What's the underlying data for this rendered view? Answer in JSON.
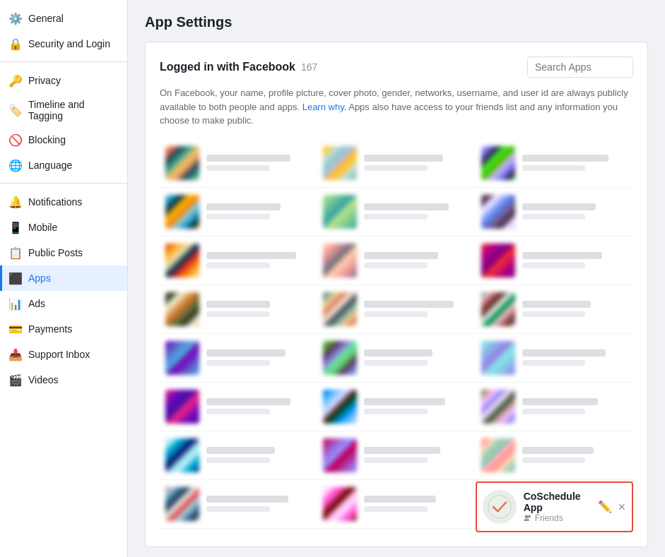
{
  "sidebar": {
    "items": [
      {
        "id": "general",
        "label": "General",
        "icon": "⚙️",
        "active": false
      },
      {
        "id": "security-login",
        "label": "Security and Login",
        "icon": "🔒",
        "active": false
      },
      {
        "id": "privacy",
        "label": "Privacy",
        "icon": "🔑",
        "active": false
      },
      {
        "id": "timeline-tagging",
        "label": "Timeline and Tagging",
        "icon": "🏷️",
        "active": false
      },
      {
        "id": "blocking",
        "label": "Blocking",
        "icon": "🚫",
        "active": false
      },
      {
        "id": "language",
        "label": "Language",
        "icon": "🌐",
        "active": false
      },
      {
        "id": "notifications",
        "label": "Notifications",
        "icon": "🔔",
        "active": false
      },
      {
        "id": "mobile",
        "label": "Mobile",
        "icon": "📱",
        "active": false
      },
      {
        "id": "public-posts",
        "label": "Public Posts",
        "icon": "📋",
        "active": false
      },
      {
        "id": "apps",
        "label": "Apps",
        "icon": "⬛",
        "active": true
      },
      {
        "id": "ads",
        "label": "Ads",
        "icon": "📊",
        "active": false
      },
      {
        "id": "payments",
        "label": "Payments",
        "icon": "💳",
        "active": false
      },
      {
        "id": "support-inbox",
        "label": "Support Inbox",
        "icon": "📥",
        "active": false
      },
      {
        "id": "videos",
        "label": "Videos",
        "icon": "🎬",
        "active": false
      }
    ]
  },
  "main": {
    "page_title": "App Settings",
    "card": {
      "logged_in_title": "Logged in with Facebook",
      "app_count": "167",
      "search_placeholder": "Search Apps",
      "info_text": "On Facebook, your name, profile picture, cover photo, gender, networks, username, and user id are always publicly available to both people and apps.",
      "learn_link_text": "Learn why.",
      "info_text2": "Apps also have access to your friends list and any information you choose to make public."
    }
  },
  "featured_app": {
    "name": "CoSchedule App",
    "sub_label": "Friends",
    "edit_icon": "✏️",
    "close_icon": "✕"
  },
  "colors": {
    "active_bg": "#e7f3ff",
    "active_border": "#1877f2",
    "accent": "#1877f2",
    "featured_border": "#e74c3c"
  }
}
